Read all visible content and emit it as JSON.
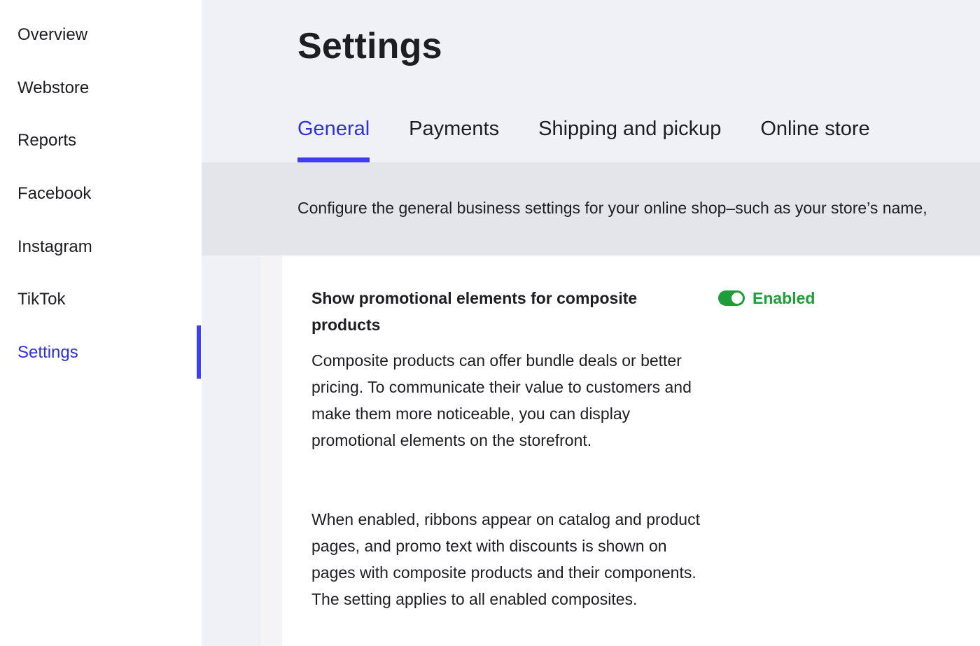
{
  "sidebar": {
    "items": [
      {
        "label": "Overview"
      },
      {
        "label": "Webstore"
      },
      {
        "label": "Reports"
      },
      {
        "label": "Facebook"
      },
      {
        "label": "Instagram"
      },
      {
        "label": "TikTok"
      },
      {
        "label": "Settings",
        "active": true
      }
    ]
  },
  "page": {
    "title": "Settings",
    "tabs": [
      {
        "label": "General",
        "active": true
      },
      {
        "label": "Payments"
      },
      {
        "label": "Shipping and pickup"
      },
      {
        "label": "Online store"
      }
    ],
    "description": "Configure the general business settings for your online shop–such as your store’s name,"
  },
  "setting": {
    "title": "Show promotional elements for composite products",
    "toggle_state": "Enabled",
    "paragraph_1": "Composite products can offer bundle deals or better pricing. To communicate their value to customers and make them more noticeable, you can display promotional elements on the storefront.",
    "paragraph_2": "When enabled, ribbons appear on catalog and product pages, and promo text with discounts is shown on pages with composite products and their components. The setting applies to all enabled composites."
  },
  "colors": {
    "accent": "#3d3df5",
    "active_text": "#2f2fe0",
    "enabled_green": "#1f9d3a",
    "main_background": "#f0f1f6",
    "description_band": "#e4e5ea"
  }
}
